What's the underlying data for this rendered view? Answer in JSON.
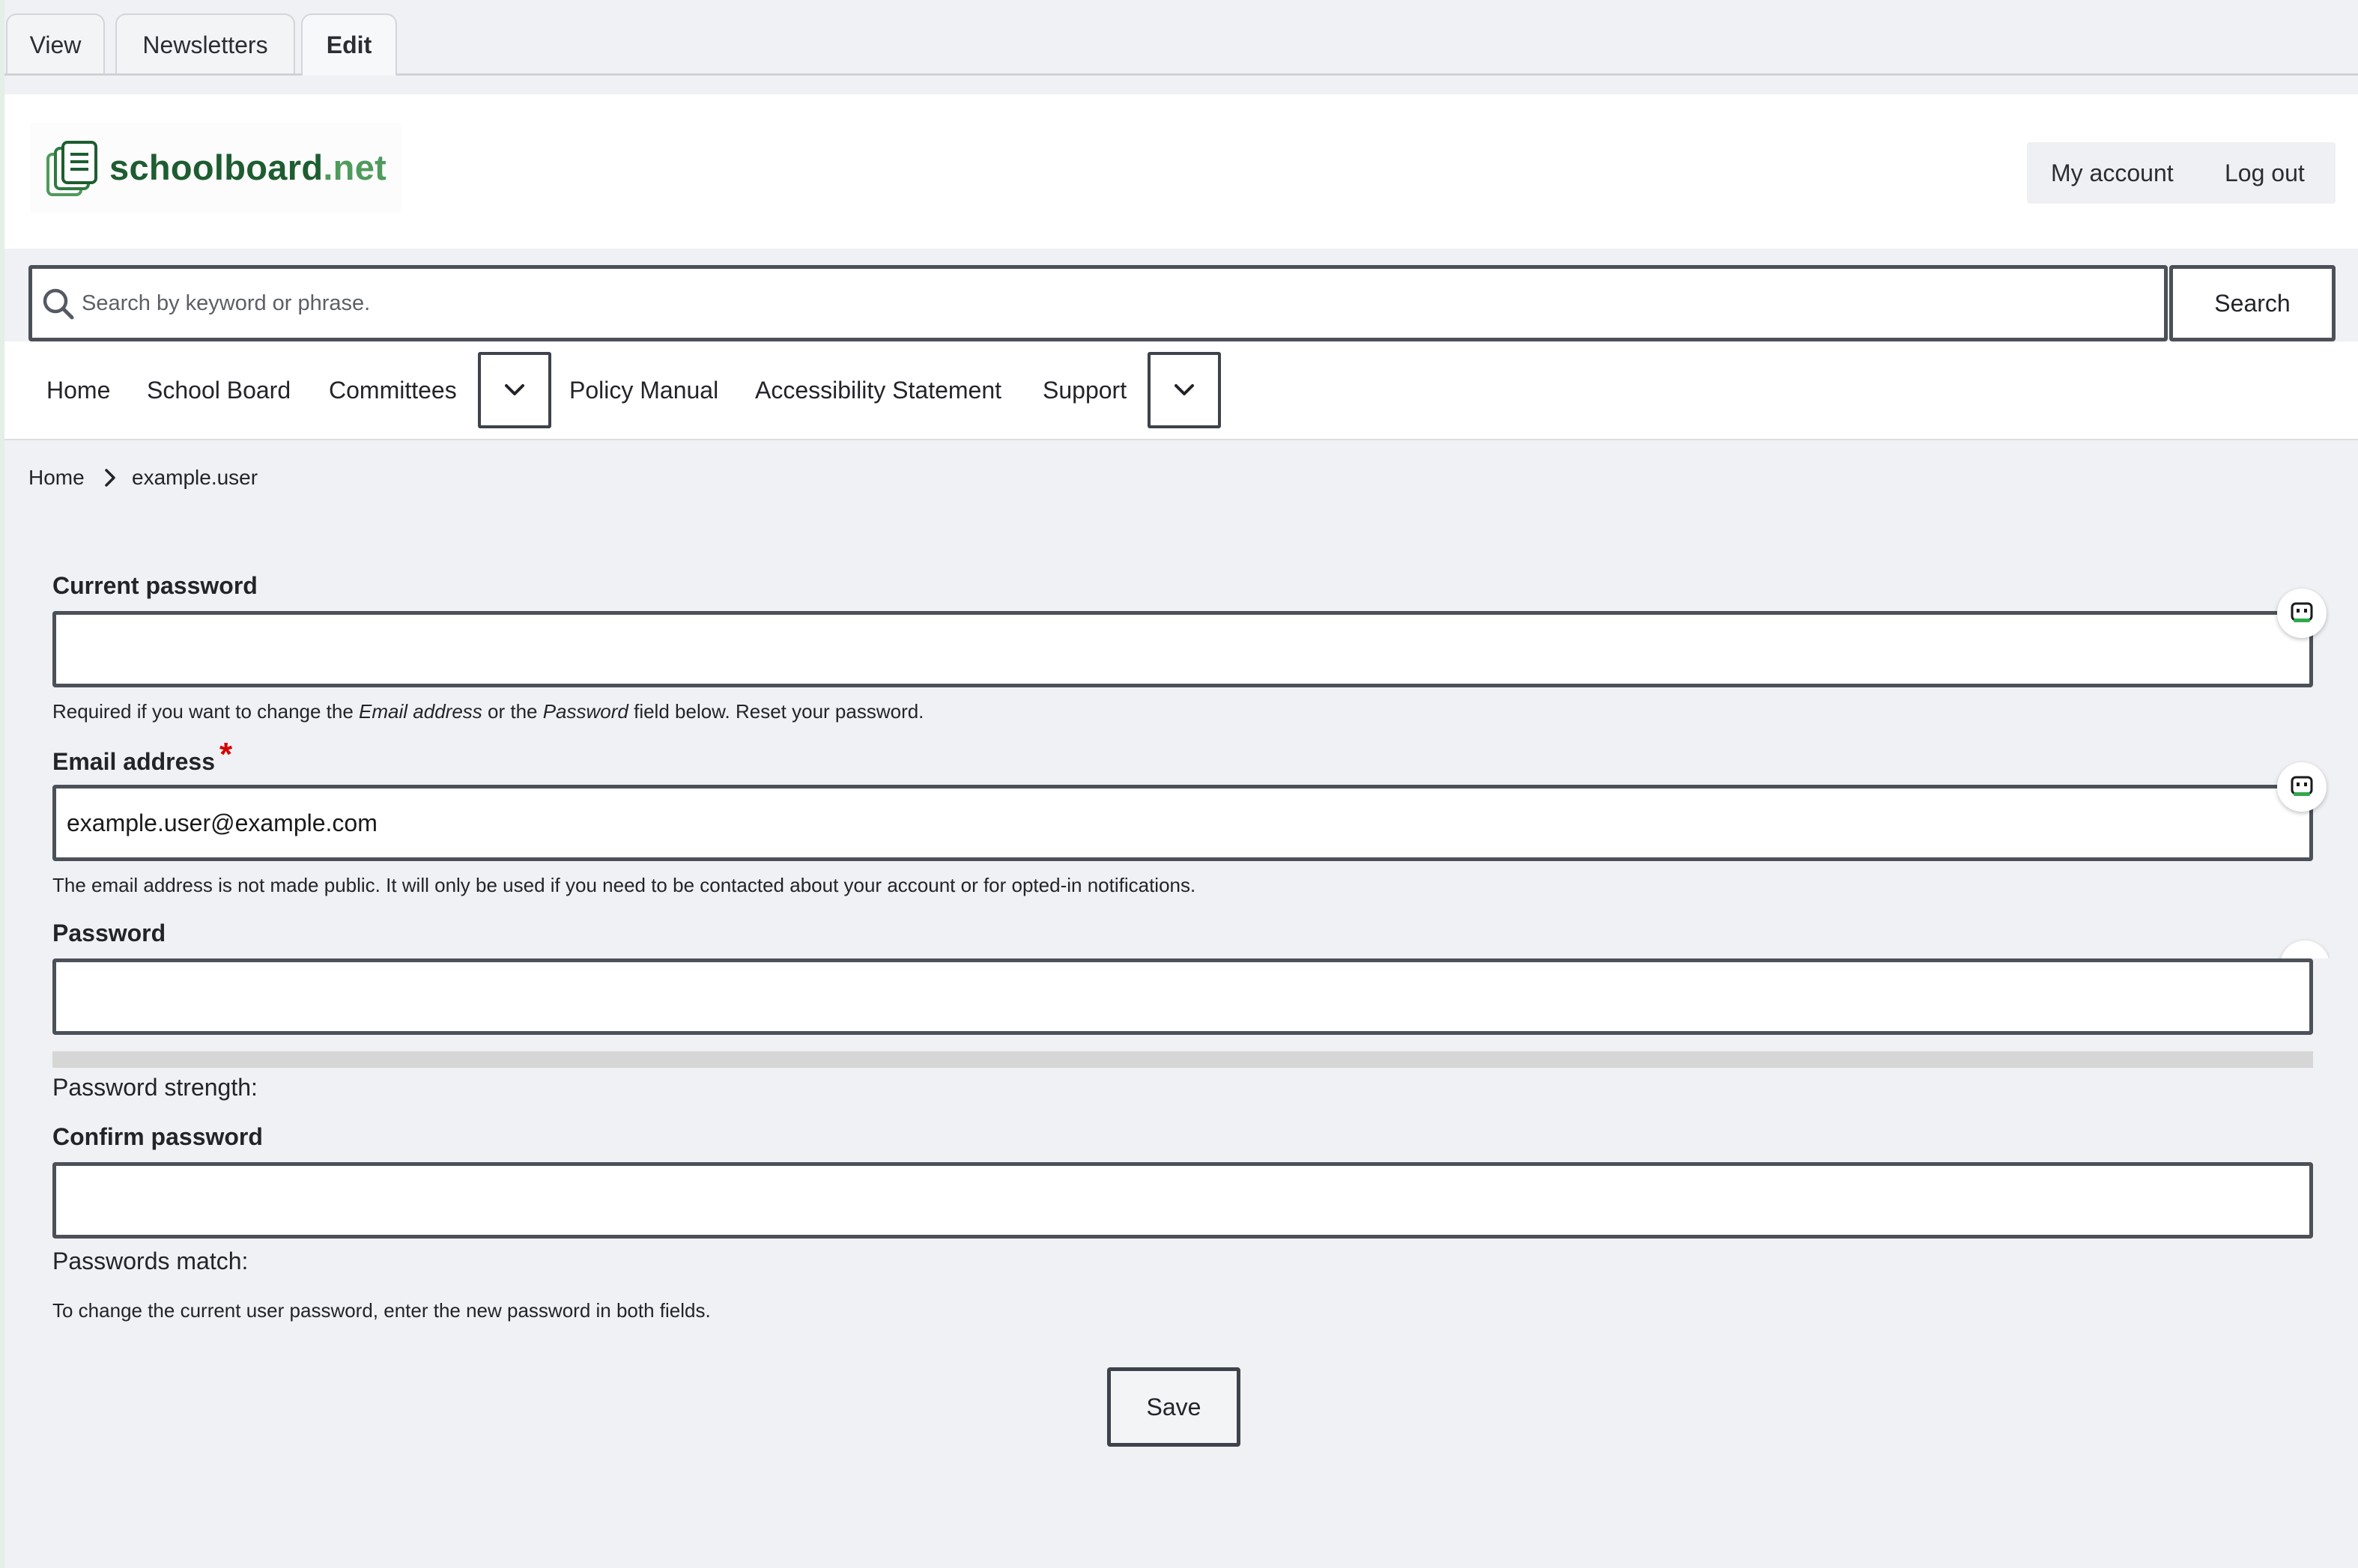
{
  "tabs": [
    "View",
    "Newsletters",
    "Edit"
  ],
  "header": {
    "logo_name": "schoolboard",
    "logo_tld": ".net",
    "my_account": "My account",
    "log_out": "Log out"
  },
  "search": {
    "placeholder": "Search by keyword or phrase.",
    "button": "Search"
  },
  "nav": {
    "home": "Home",
    "school_board": "School Board",
    "committees": "Committees",
    "policy_manual": "Policy Manual",
    "accessibility": "Accessibility Statement",
    "support": "Support"
  },
  "breadcrumb": {
    "home": "Home",
    "current": "example.user"
  },
  "form": {
    "current_password": {
      "label": "Current password",
      "value": "",
      "desc_pre": "Required if you want to change the ",
      "desc_em1": "Email address",
      "desc_mid": " or the ",
      "desc_em2": "Password",
      "desc_post": " field below. Reset your password."
    },
    "email": {
      "label": "Email address",
      "required_mark": "*",
      "value": "example.user@example.com",
      "desc": "The email address is not made public. It will only be used if you need to be contacted about your account or for opted-in notifications."
    },
    "password": {
      "label": "Password",
      "value": "",
      "strength_label": "Password strength:",
      "strength_level": 0
    },
    "confirm_password": {
      "label": "Confirm password",
      "value": "",
      "match_label": "Passwords match:",
      "desc": "To change the current user password, enter the new password in both fields."
    },
    "save": "Save"
  },
  "colors": {
    "brand_dark": "#1e5d31",
    "brand_light": "#4f9a5d",
    "required": "#d70000",
    "border": "#4c5059"
  }
}
